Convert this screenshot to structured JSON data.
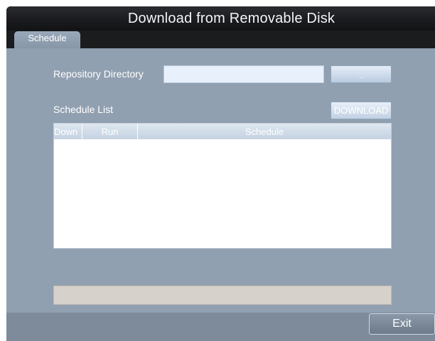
{
  "window": {
    "title": "Download from  Removable Disk"
  },
  "tabs": [
    {
      "label": "Schedule",
      "active": true
    }
  ],
  "repository": {
    "label": "Repository Directory",
    "value": "",
    "browse_label": ".."
  },
  "schedule": {
    "label": "Schedule List",
    "download_label": "DOWNLOAD",
    "columns": [
      "Down",
      "Run",
      "Schedule"
    ],
    "rows": []
  },
  "progress": {
    "value": 0
  },
  "footer": {
    "exit_label": "Exit"
  },
  "colors": {
    "panel": "#91a0b0",
    "titlebar": "#1b1c1e",
    "footer": "#7d8b9a"
  }
}
